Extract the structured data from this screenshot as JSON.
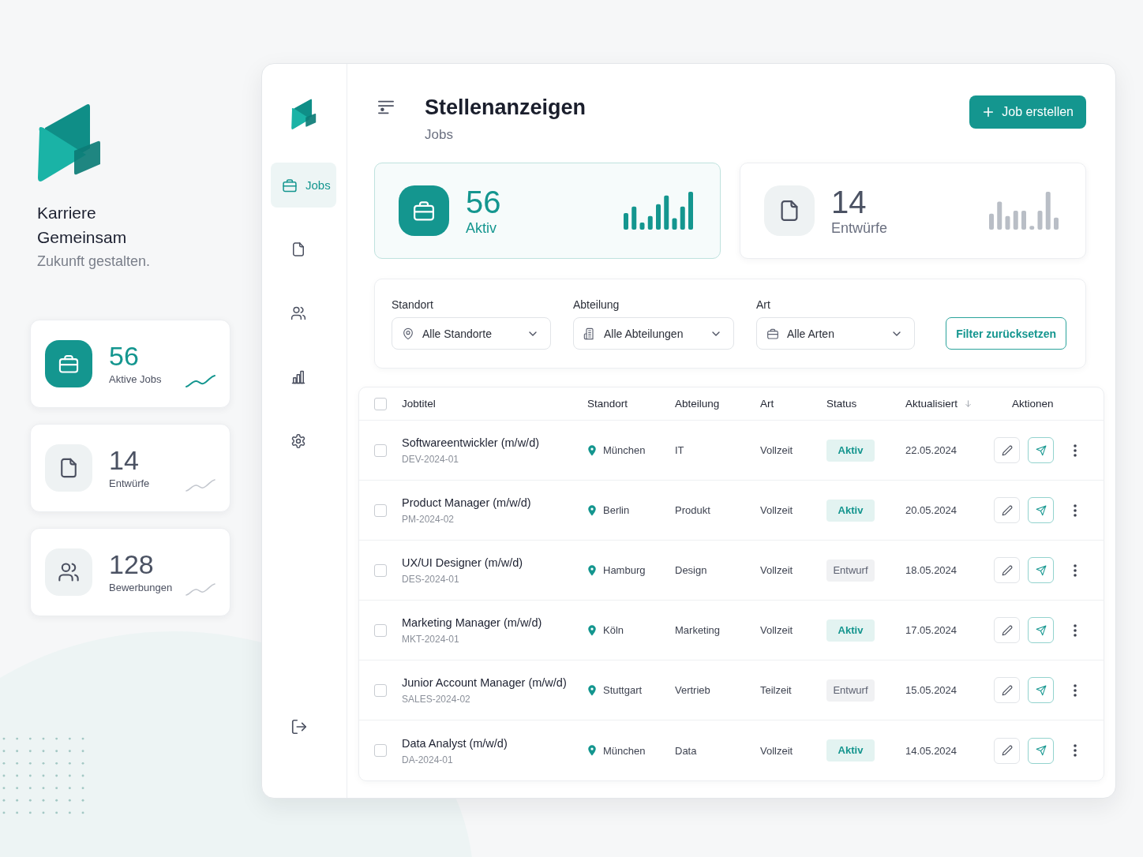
{
  "brand": {
    "name": "Karriere Gemeinsam",
    "tagline": "Zukunft gestalten."
  },
  "summary_cards": [
    {
      "value": "56",
      "label": "Aktive Jobs",
      "accent": true
    },
    {
      "value": "14",
      "label": "Entwürfe",
      "accent": false
    },
    {
      "value": "128",
      "label": "Bewerbungen",
      "accent": false
    }
  ],
  "sidebar": {
    "items": [
      {
        "label": "Jobs",
        "selected": true
      },
      {
        "selected": false
      },
      {
        "selected": false
      },
      {
        "selected": false
      },
      {
        "selected": false
      }
    ]
  },
  "header": {
    "title": "Stellenanzeigen",
    "subtitle": "Jobs",
    "create_button": "Job erstellen"
  },
  "stats": [
    {
      "value": "56",
      "label": "Aktiv",
      "selected": true
    },
    {
      "value": "14",
      "label": "Entwürfe",
      "selected": false
    }
  ],
  "filters": {
    "fields": [
      {
        "label": "Standort",
        "value": "Alle Standorte"
      },
      {
        "label": "Abteilung",
        "value": "Alle Abteilungen"
      },
      {
        "label": "Art",
        "value": "Alle Arten"
      }
    ],
    "reset_button": "Filter zurücksetzen"
  },
  "table": {
    "select_all_checked": false,
    "columns": [
      {
        "label": "Jobtitel",
        "sorted": false
      },
      {
        "label": "Standort",
        "sorted": false
      },
      {
        "label": "Abteilung",
        "sorted": false
      },
      {
        "label": "Art",
        "sorted": false
      },
      {
        "label": "Status",
        "sorted": false
      },
      {
        "label": "Aktualisiert",
        "sorted": true
      },
      {
        "label": "Aktionen",
        "sorted": false
      }
    ],
    "rows": [
      {
        "checked": false,
        "title": "Softwareentwickler (m/w/d)",
        "code": "DEV-2024-01",
        "location": "München",
        "department": "IT",
        "type": "Vollzeit",
        "status": {
          "label": "Aktiv",
          "kind": "active"
        },
        "updated": "22.05.2024"
      },
      {
        "checked": false,
        "title": "Product Manager (m/w/d)",
        "code": "PM-2024-02",
        "location": "Berlin",
        "department": "Produkt",
        "type": "Vollzeit",
        "status": {
          "label": "Aktiv",
          "kind": "active"
        },
        "updated": "20.05.2024"
      },
      {
        "checked": false,
        "title": "UX/UI Designer (m/w/d)",
        "code": "DES-2024-01",
        "location": "Hamburg",
        "department": "Design",
        "type": "Vollzeit",
        "status": {
          "label": "Entwurf",
          "kind": "draft"
        },
        "updated": "18.05.2024"
      },
      {
        "checked": false,
        "title": "Marketing Manager (m/w/d)",
        "code": "MKT-2024-01",
        "location": "Köln",
        "department": "Marketing",
        "type": "Vollzeit",
        "status": {
          "label": "Aktiv",
          "kind": "active"
        },
        "updated": "17.05.2024"
      },
      {
        "checked": false,
        "title": "Junior Account Manager (m/w/d)",
        "code": "SALES-2024-02",
        "location": "Stuttgart",
        "department": "Vertrieb",
        "type": "Teilzeit",
        "status": {
          "label": "Entwurf",
          "kind": "draft"
        },
        "updated": "15.05.2024"
      },
      {
        "checked": false,
        "title": "Data Analyst (m/w/d)",
        "code": "DA-2024-01",
        "location": "München",
        "department": "Data",
        "type": "Vollzeit",
        "status": {
          "label": "Aktiv",
          "kind": "active"
        },
        "updated": "14.05.2024"
      }
    ]
  }
}
